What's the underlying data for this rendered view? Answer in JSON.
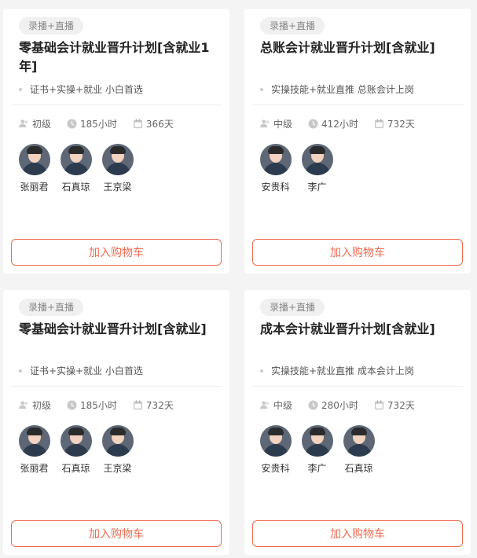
{
  "cards": [
    {
      "tag": "录播+直播",
      "title": "零基础会计就业晋升计划[含就业1年]",
      "subtitle": "证书+实操+就业 小白首选",
      "level": "初级",
      "hours": "185小时",
      "days": "366天",
      "teachers": [
        "张丽君",
        "石真琼",
        "王京梁"
      ],
      "button": "加入购物车"
    },
    {
      "tag": "录播+直播",
      "title": "总账会计就业晋升计划[含就业]",
      "subtitle": "实操技能+就业直推 总账会计上岗",
      "level": "中级",
      "hours": "412小时",
      "days": "732天",
      "teachers": [
        "安贵科",
        "李广"
      ],
      "button": "加入购物车"
    },
    {
      "tag": "录播+直播",
      "title": "零基础会计就业晋升计划[含就业]",
      "subtitle": "证书+实操+就业 小白首选",
      "level": "初级",
      "hours": "185小时",
      "days": "732天",
      "teachers": [
        "张丽君",
        "石真琼",
        "王京梁"
      ],
      "button": "加入购物车"
    },
    {
      "tag": "录播+直播",
      "title": "成本会计就业晋升计划[含就业]",
      "subtitle": "实操技能+就业直推 成本会计上岗",
      "level": "中级",
      "hours": "280小时",
      "days": "732天",
      "teachers": [
        "安贵科",
        "李广",
        "石真琼"
      ],
      "button": "加入购物车"
    }
  ],
  "icons": {
    "level": "level-icon",
    "hours": "clock-icon",
    "days": "calendar-icon"
  },
  "colors": {
    "accent": "#f06a50",
    "background": "#f4f4f4"
  }
}
